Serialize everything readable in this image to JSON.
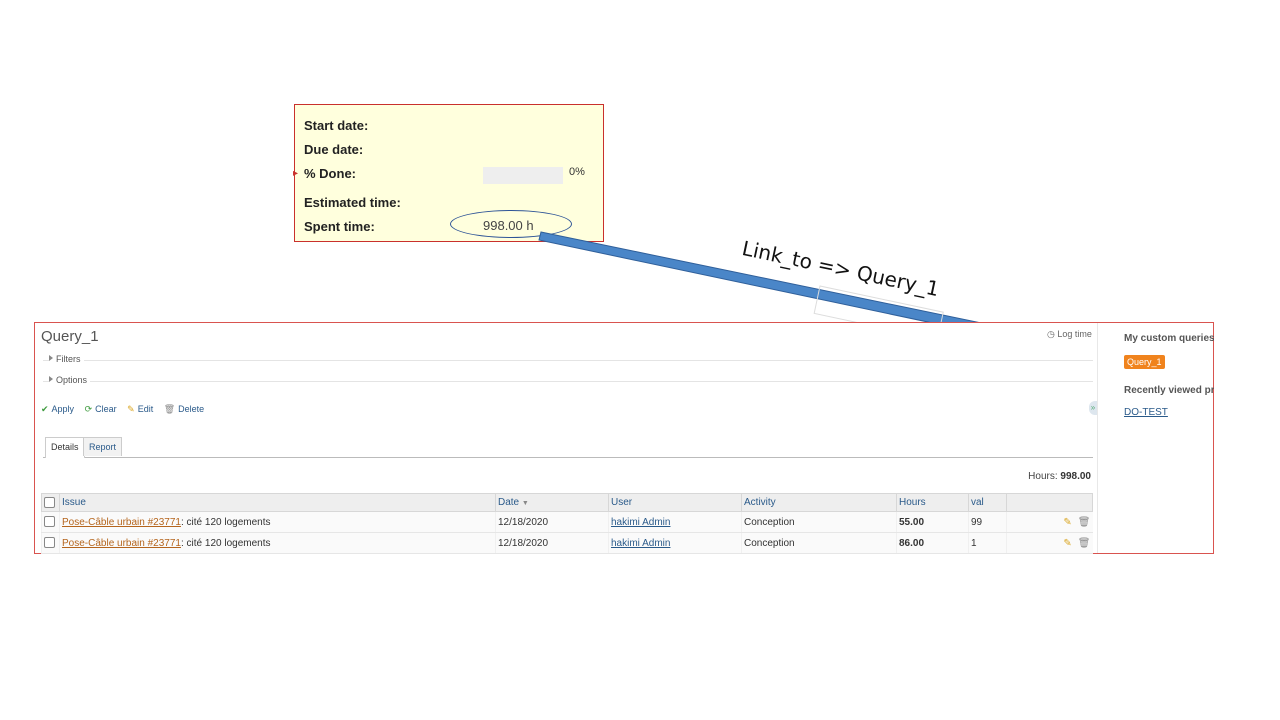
{
  "attributes": {
    "start_date_label": "Start date:",
    "due_date_label": "Due date:",
    "done_label": "% Done:",
    "done_value": 0,
    "done_text": "0%",
    "estimated_label": "Estimated time:",
    "spent_label": "Spent time:",
    "spent_value": "998.00 h"
  },
  "annotation": {
    "text": "Link_to => Query_1",
    "arrow_color": "#4a86c8"
  },
  "query_page": {
    "title": "Query_1",
    "log_time": "Log time",
    "filters_label": "Filters",
    "options_label": "Options",
    "actions": {
      "apply": "Apply",
      "clear": "Clear",
      "edit": "Edit",
      "delete": "Delete"
    },
    "tabs": [
      "Details",
      "Report"
    ],
    "hours_total_label": "Hours:",
    "hours_total_value": "998.00",
    "columns": [
      "Issue",
      "Date",
      "User",
      "Activity",
      "Hours",
      "val"
    ],
    "rows": [
      {
        "issue_link": "Pose-Câble urbain #23771",
        "issue_subject": ": cité 120 logements",
        "date": "12/18/2020",
        "user": "hakimi Admin",
        "activity": "Conception",
        "hours": "55.00",
        "val": "99"
      },
      {
        "issue_link": "Pose-Câble urbain #23771",
        "issue_subject": ": cité 120 logements",
        "date": "12/18/2020",
        "user": "hakimi Admin",
        "activity": "Conception",
        "hours": "86.00",
        "val": "1"
      }
    ]
  },
  "sidebar": {
    "custom_queries_heading": "My custom queries",
    "custom_query": "Query_1",
    "recent_heading": "Recently viewed pro",
    "recent_project": "DO-TEST"
  },
  "colors": {
    "panel_border": "#c9302c",
    "panel_bg": "#ffffdd",
    "query_badge": "#f0831d",
    "link": "#2a5a8a"
  }
}
